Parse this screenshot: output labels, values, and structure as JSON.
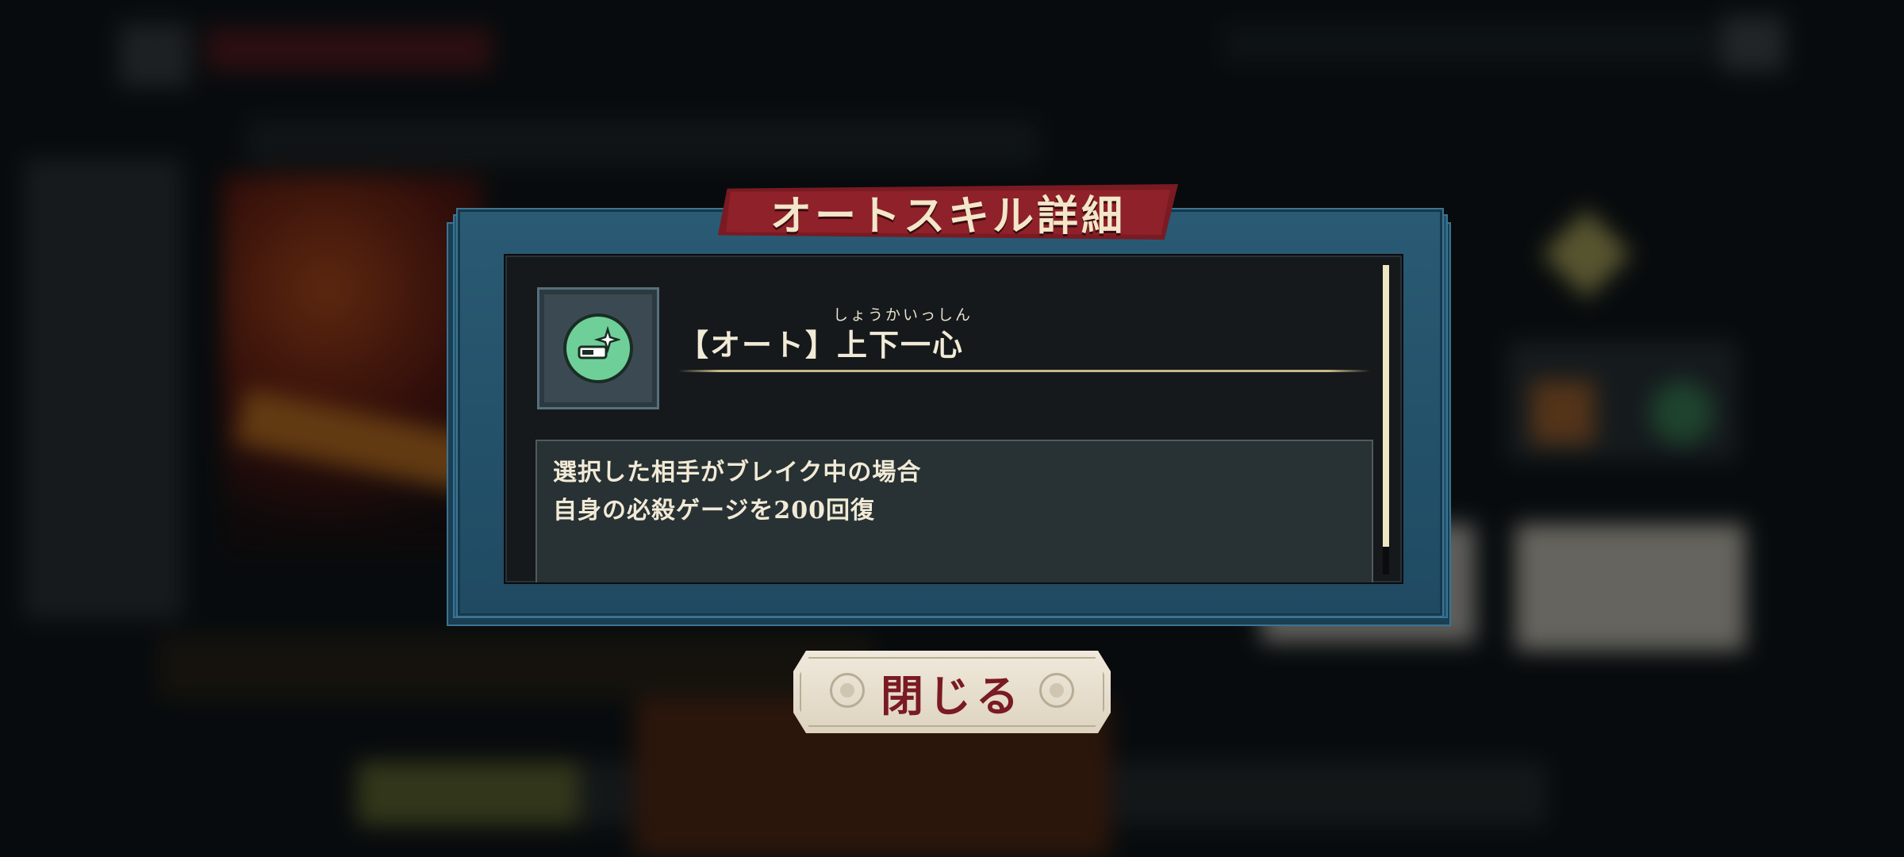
{
  "modal": {
    "title": "オートスキル詳細",
    "skill": {
      "ruby": "しょうかいっしん",
      "name": "【オート】上下一心",
      "icon": "auto-skill-gauge-icon",
      "description": [
        "選択した相手がブレイク中の場合",
        "自身の必殺ゲージを200回復"
      ]
    },
    "close_label": "閉じる"
  },
  "colors": {
    "banner": "#8e2129",
    "frame": "#1f4d66",
    "icon_green": "#6fcf98",
    "text_light": "#f1ead6",
    "button_text": "#7a1a22"
  }
}
